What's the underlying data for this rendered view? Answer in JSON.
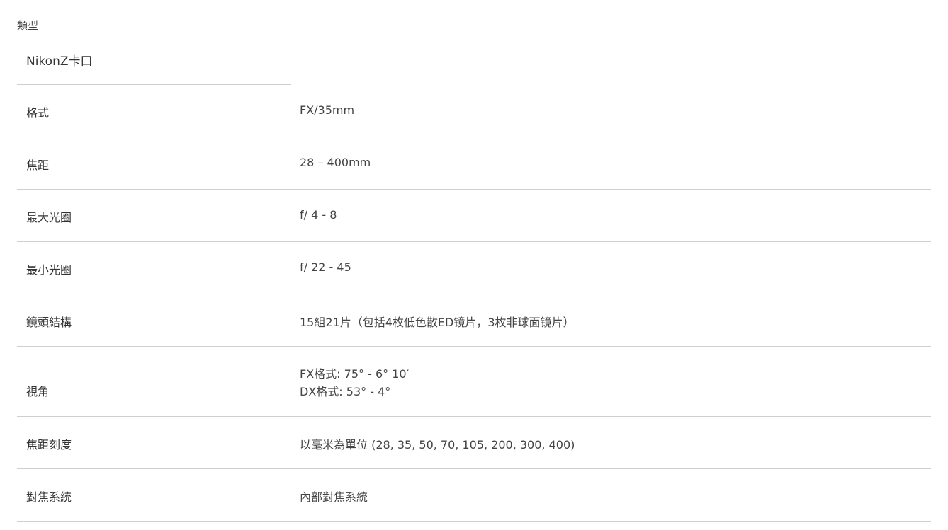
{
  "type_section": {
    "heading": "類型",
    "value": "NikonZ卡口"
  },
  "specs": [
    {
      "label": "格式",
      "value": "FX/35mm"
    },
    {
      "label": "焦距",
      "value": "28 – 400mm"
    },
    {
      "label": "最大光圈",
      "value": "f/ 4 - 8"
    },
    {
      "label": "最小光圈",
      "value": "f/ 22 - 45"
    },
    {
      "label": "鏡頭結構",
      "value": "15組21片（包括4枚低色散ED镜片，3枚非球面镜片）"
    },
    {
      "label": "視角",
      "value_lines": [
        "FX格式: 75° - 6° 10′",
        "DX格式: 53° - 4°"
      ]
    },
    {
      "label": "焦距刻度",
      "value": "以毫米為單位 (28, 35, 50, 70, 105, 200, 300, 400)"
    },
    {
      "label": "對焦系統",
      "value": "內部對焦系統"
    }
  ]
}
